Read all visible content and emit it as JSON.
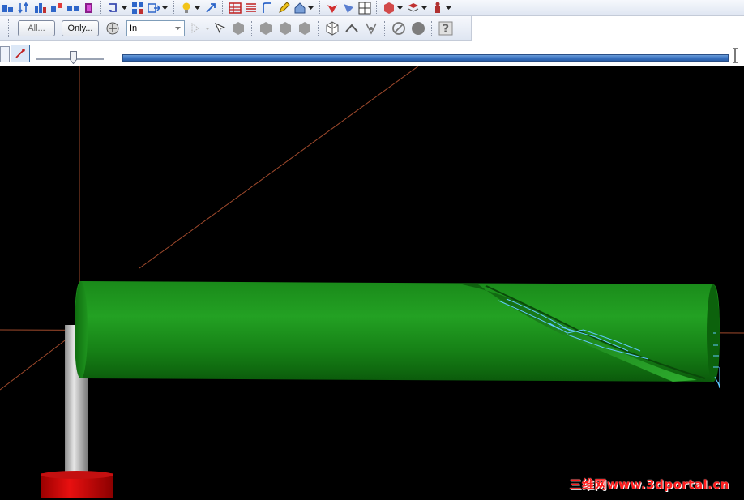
{
  "toolbar_row2": {
    "all_button_label": "All...",
    "only_button_label": "Only...",
    "units_select_value": "In"
  },
  "viewport": {
    "background_color": "#000000",
    "model_color": "#1f8a1f",
    "holder_color": "#b4b4b4",
    "base_color": "#d40000",
    "axis_color": "#a04a2c",
    "toolpath_color": "#5fc8ff"
  },
  "watermark": {
    "text": "三维网www.3dportal.cn"
  },
  "progress": {
    "fraction": 0.99
  },
  "slider": {
    "position_fraction": 0.55
  }
}
